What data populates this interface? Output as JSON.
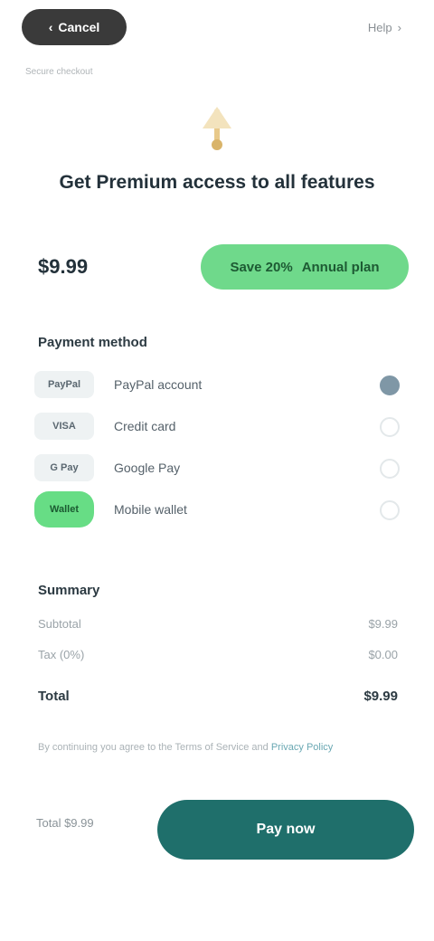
{
  "header": {
    "back_label": "Cancel",
    "help_label": "Help",
    "subtitle": "Secure checkout"
  },
  "product": {
    "title": "Get Premium access to all features",
    "price": "$9.99",
    "badge_label": "Save 20%",
    "badge_sub": "Annual plan"
  },
  "payment": {
    "section_label": "Payment method",
    "methods": [
      {
        "logo": "PayPal",
        "name": "PayPal account",
        "selected": true
      },
      {
        "logo": "VISA",
        "name": "Credit card",
        "selected": false
      },
      {
        "logo": "G Pay",
        "name": "Google Pay",
        "selected": false
      },
      {
        "logo": "Wallet",
        "name": "Mobile wallet",
        "selected": false
      }
    ]
  },
  "summary": {
    "section_label": "Summary",
    "rows": [
      {
        "label": "Subtotal",
        "value": "$9.99"
      },
      {
        "label": "Tax (0%)",
        "value": "$0.00"
      }
    ],
    "total_label": "Total",
    "total_value": "$9.99"
  },
  "terms": {
    "text": "By continuing you agree to the Terms of Service and",
    "link": "Privacy Policy"
  },
  "footer": {
    "total_text": "Total $9.99",
    "pay_label": "Pay now"
  },
  "colors": {
    "accent": "#1f6f6b",
    "highlight": "#6fd98b"
  }
}
